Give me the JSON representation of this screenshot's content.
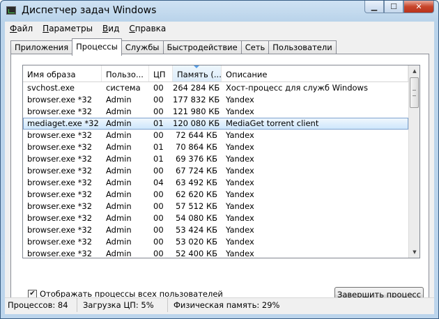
{
  "window": {
    "title": "Диспетчер задач Windows"
  },
  "menu": [
    {
      "hot": "Ф",
      "rest": "айл"
    },
    {
      "hot": "П",
      "rest": "араметры"
    },
    {
      "hot": "В",
      "rest": "ид"
    },
    {
      "hot": "С",
      "rest": "правка"
    }
  ],
  "tabs": [
    "Приложения",
    "Процессы",
    "Службы",
    "Быстродействие",
    "Сеть",
    "Пользователи"
  ],
  "active_tab": "Процессы",
  "columns": [
    "Имя образа",
    "Пользо...",
    "ЦП",
    "Память (...",
    "Описание"
  ],
  "processes": [
    {
      "name": "svchost.exe",
      "user": "система",
      "cpu": "00",
      "mem": "264 284 КБ",
      "desc": "Хост-процесс для служб Windows"
    },
    {
      "name": "browser.exe *32",
      "user": "Admin",
      "cpu": "00",
      "mem": "177 832 КБ",
      "desc": "Yandex"
    },
    {
      "name": "browser.exe *32",
      "user": "Admin",
      "cpu": "00",
      "mem": "121 980 КБ",
      "desc": "Yandex"
    },
    {
      "name": "mediaget.exe *32",
      "user": "Admin",
      "cpu": "01",
      "mem": "120 080 КБ",
      "desc": "MediaGet torrent client"
    },
    {
      "name": "browser.exe *32",
      "user": "Admin",
      "cpu": "00",
      "mem": "72 644 КБ",
      "desc": "Yandex"
    },
    {
      "name": "browser.exe *32",
      "user": "Admin",
      "cpu": "01",
      "mem": "70 864 КБ",
      "desc": "Yandex"
    },
    {
      "name": "browser.exe *32",
      "user": "Admin",
      "cpu": "01",
      "mem": "69 376 КБ",
      "desc": "Yandex"
    },
    {
      "name": "browser.exe *32",
      "user": "Admin",
      "cpu": "00",
      "mem": "67 724 КБ",
      "desc": "Yandex"
    },
    {
      "name": "browser.exe *32",
      "user": "Admin",
      "cpu": "04",
      "mem": "63 492 КБ",
      "desc": "Yandex"
    },
    {
      "name": "browser.exe *32",
      "user": "Admin",
      "cpu": "00",
      "mem": "62 620 КБ",
      "desc": "Yandex"
    },
    {
      "name": "browser.exe *32",
      "user": "Admin",
      "cpu": "00",
      "mem": "57 512 КБ",
      "desc": "Yandex"
    },
    {
      "name": "browser.exe *32",
      "user": "Admin",
      "cpu": "00",
      "mem": "54 080 КБ",
      "desc": "Yandex"
    },
    {
      "name": "browser.exe *32",
      "user": "Admin",
      "cpu": "00",
      "mem": "53 424 КБ",
      "desc": "Yandex"
    },
    {
      "name": "browser.exe *32",
      "user": "Admin",
      "cpu": "00",
      "mem": "53 020 КБ",
      "desc": "Yandex"
    },
    {
      "name": "browser.exe *32",
      "user": "Admin",
      "cpu": "00",
      "mem": "52 400 КБ",
      "desc": "Yandex"
    }
  ],
  "selected_process": "mediaget.exe *32",
  "show_all_users": {
    "checked": true,
    "label_before": "Отобра",
    "hot": "ж",
    "label_after": "ать процессы всех пользователей"
  },
  "end_process_button": {
    "hot": "З",
    "rest": "авершить процесс"
  },
  "status": {
    "processes": "Процессов: 84",
    "cpu": "Загрузка ЦП: 5%",
    "memory": "Физическая память: 29%"
  },
  "colors": {
    "selection": "#cbe5fb",
    "sorted_column": "#dcecfa",
    "close_button": "#c7452b"
  }
}
